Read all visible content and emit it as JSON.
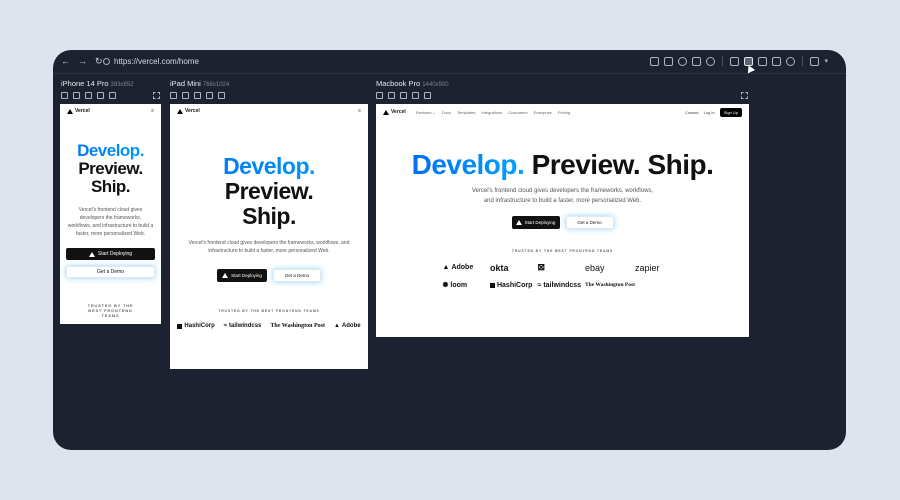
{
  "browser": {
    "url": "https://vercel.com/home",
    "nav": [
      "←",
      "→",
      "↻"
    ],
    "toolbar_icons": [
      "responsive-icon",
      "device-icon",
      "wifi-icon",
      "home-icon",
      "star-icon",
      "rotate-icon",
      "screenshot-active-icon",
      "camera-icon",
      "file-icon",
      "layers-icon",
      "layout-icon"
    ]
  },
  "devices": [
    {
      "name": "iPhone 14 Pro",
      "dims": "393x852"
    },
    {
      "name": "iPad Mini",
      "dims": "768x1024"
    },
    {
      "name": "Macbook Pro",
      "dims": "1440x900"
    }
  ],
  "site": {
    "brand": "Vercel",
    "menu": "≡",
    "nav_links": [
      "Features ⌄",
      "Docs",
      "Templates",
      "Integrations",
      "Customers",
      "Enterprise",
      "Pricing"
    ],
    "contact": "Contact",
    "login": "Log In",
    "signup": "Sign Up",
    "hero_1": "Develop.",
    "hero_2": "Preview.",
    "hero_3": "Ship.",
    "desc": "Vercel's frontend cloud gives developers the frameworks, workflows, and infrastructure to build a faster, more personalized Web.",
    "cta_primary": "Start Deploying",
    "cta_secondary": "Get a Demo",
    "trusted": "TRUSTED BY THE BEST FRONTEND TEAMS",
    "logos": [
      "Adobe",
      "okta",
      "ebay",
      "zapier",
      "loom",
      "HashiCorp",
      "tailwindcss",
      "The Washington Post"
    ]
  },
  "colors": {
    "accent_blue": "#0070f3",
    "window_bg": "#1d2230",
    "page_bg": "#dfe3ee"
  }
}
